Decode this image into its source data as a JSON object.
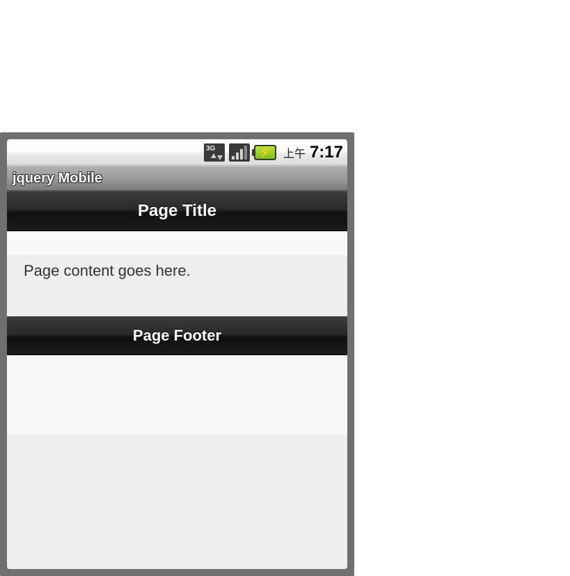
{
  "statusBar": {
    "timePrefix": "上午",
    "time": "7:17"
  },
  "app": {
    "title": "jquery Mobile"
  },
  "page": {
    "header": "Page Title",
    "content": "Page content goes here.",
    "footer": "Page Footer"
  }
}
